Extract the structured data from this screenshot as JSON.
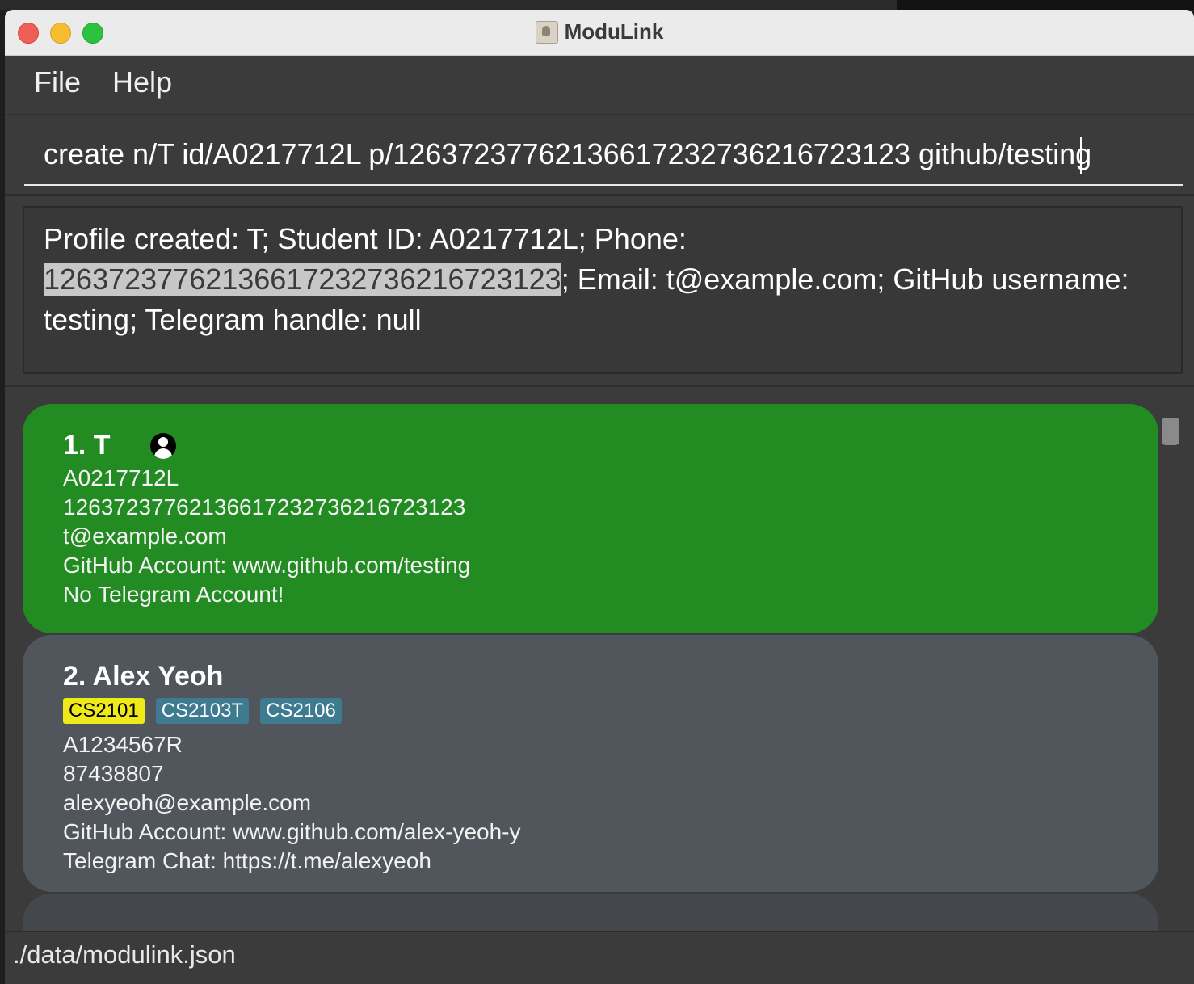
{
  "window": {
    "title": "ModuLink"
  },
  "menu": {
    "file": "File",
    "help": "Help"
  },
  "command": {
    "value": "create n/T id/A0217712L p/126372377621366172327362167231​23 github/testing"
  },
  "result": {
    "prefix": "Profile created: T; Student ID: A0217712L; Phone:",
    "highlighted": "126372377621366172327362167231​23",
    "suffix": "; Email: t@example.com; GitHub username: testing; Telegram handle: null"
  },
  "persons": [
    {
      "name": "1. T",
      "tags": [],
      "id": "A0217712L",
      "phone": "126372377621366172327362167231​23",
      "email": "t@example.com",
      "github": "GitHub Account: www.github.com/testing",
      "telegram": "No Telegram Account!",
      "card_color": "#228b22"
    },
    {
      "name": "2. Alex Yeoh",
      "tags": [
        "CS2101",
        "CS2103T",
        "CS2106"
      ],
      "id": "A1234567R",
      "phone": "87438807",
      "email": "alexyeoh@example.com",
      "github": "GitHub Account: www.github.com/alex-yeoh-y",
      "telegram": "Telegram Chat: https://t.me/alexyeoh",
      "card_color": "#50565c"
    }
  ],
  "status": {
    "file_path": "./data/modulink.json"
  },
  "colors": {
    "window_bg": "#3b3b3b",
    "highlight_tag": "#f0e91a",
    "tag": "#3e7b91"
  }
}
